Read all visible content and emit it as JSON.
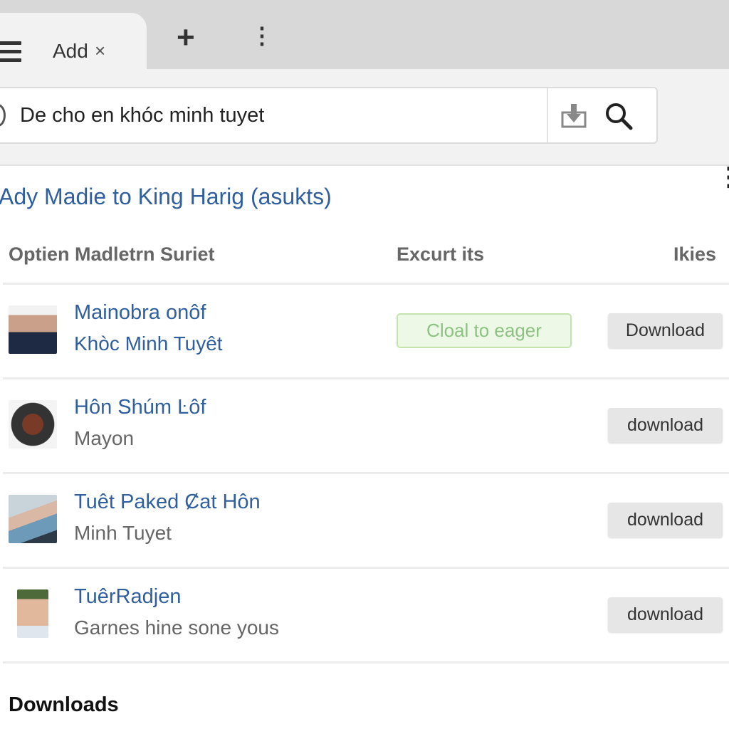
{
  "tabs": {
    "active_label": "Add",
    "close": "×",
    "new_tab": "+",
    "more": "⋮",
    "menu_icon": "hamburger-icon"
  },
  "omnibox": {
    "value": "De cho en khóc minh tuyet",
    "icons": [
      "download-icon",
      "search-icon"
    ],
    "more": "⋮"
  },
  "page": {
    "title": "Ady Madie to King Harig (asukts)",
    "columns": [
      "Optien Madletrn Suriet",
      "Excurt its",
      "Ikies"
    ],
    "rows": [
      {
        "name": "Mainobra onôf",
        "sub": "Khòc Minh Tuyêt",
        "sub_style": "link",
        "status": "Cloal to eager",
        "action": "Download"
      },
      {
        "name": "Hôn Shúm Ŀôf",
        "sub": "Mayon",
        "sub_style": "muted",
        "action": "download"
      },
      {
        "name": "Tuêt Paked Ȼat Hôn",
        "sub": "Minh Tuyet",
        "sub_style": "muted",
        "action": "download"
      },
      {
        "name": "TuêrRadjen",
        "sub": "Garnes hine sone yous",
        "sub_style": "muted",
        "action": "download"
      }
    ],
    "section": "Downloads"
  },
  "colors": {
    "link": "#2f5f9e",
    "status_bg": "#eef8e7",
    "status_text": "#8dc283",
    "button_bg": "#e6e6e6"
  }
}
